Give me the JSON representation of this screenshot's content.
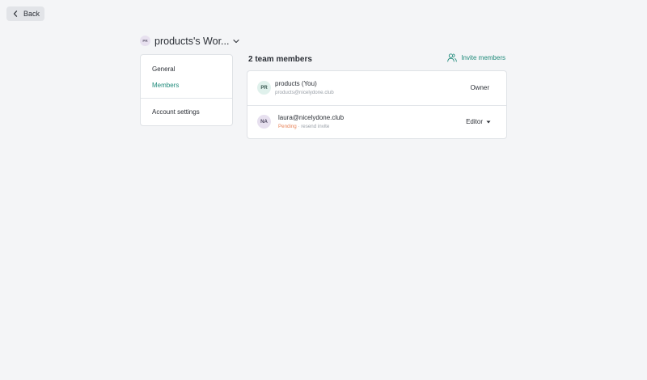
{
  "back": {
    "label": "Back",
    "icon": "chevron-left-icon"
  },
  "workspace": {
    "avatar_initials": "PR",
    "name": "products's Wor...",
    "dropdown_icon": "chevron-down-icon"
  },
  "sidebar": {
    "items": [
      {
        "label": "General",
        "active": false
      },
      {
        "label": "Members",
        "active": true
      },
      {
        "label": "Account settings",
        "active": false
      }
    ]
  },
  "members_panel": {
    "title": "2 team members",
    "invite_label": "Invite members",
    "invite_icon": "users-add-icon",
    "members": [
      {
        "initials": "PR",
        "name": "products (You)",
        "email": "products@nicelydone.club",
        "role": "Owner"
      },
      {
        "initials": "NA",
        "name": "laura@nicelydone.club",
        "status": "Pending",
        "separator": "·",
        "resend_label": "resend invite",
        "role": "Editor"
      }
    ]
  },
  "colors": {
    "background": "#f4f5f7",
    "accent": "#1f8a7a",
    "pending": "#e8845a"
  }
}
